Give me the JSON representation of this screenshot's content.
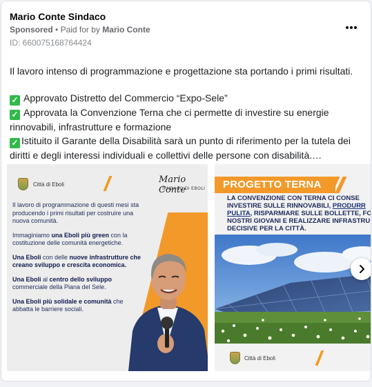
{
  "post": {
    "page_name": "Mario Conte Sindaco",
    "sponsored_label": "Sponsored",
    "paid_for_prefix": "Paid for by",
    "paid_for_name": "Mario Conte",
    "ad_id": "ID: 660075168764424",
    "body": {
      "intro": "Il lavoro intenso di programmazione e progettazione sta portando i primi risultati.",
      "item1": "Approvato Distretto del Commercio “Expo-Sele”",
      "item2": "Approvata la Convenzione Terna che ci permette di investire su energie rinnovabili, infrastrutture e formazione",
      "item3": "Istituito il Garante della Disabilità sarà un punto di riferimento per la tutela dei diritti e degli interessi individuali e collettivi delle persone con disabilità.…"
    }
  },
  "slide1": {
    "city": "Città di Eboli",
    "signature": "Mario Conte",
    "signature_title": "SINDACO DI EBOLI",
    "p1": "Il lavoro di programmazione di questi mesi sta producendo i primi risultati per costruire una nuova comunità.",
    "p2_a": "Immaginiamo ",
    "p2_b": "una Eboli più green",
    "p2_c": " con la costituzione delle comunità energetiche.",
    "p3_a": "Una Eboli",
    "p3_b": " con delle ",
    "p3_c": "nuove infrastrutture che creano sviluppo e crescita economica.",
    "p4_a": "Una Eboli",
    "p4_b": " al ",
    "p4_c": "centro dello sviluppo",
    "p4_d": " commerciale della Piana del Sele.",
    "p5_a": "Una Eboli più solidale e comunità",
    "p5_b": " che abbatta le barriere sociali."
  },
  "slide2": {
    "title": "PROGETTO TERNA",
    "line1": "LA CONVENZIONE CON TERNA CI CONSE",
    "line2_a": "INVESTIRE SULLE RINNOVABILI, ",
    "line2_b": "PRODURR",
    "line3_a": "PULITA",
    "line3_b": ", RISPARMIARE SULLE BOLLETTE, FO",
    "line4": "NOSTRI GIOVANI E REALIZZARE INFRASTRU",
    "line5": "DECISIVE PER LA CITTÀ.",
    "city": "Città di Eboli"
  },
  "icons": {
    "more": "more-horizontal-icon",
    "next": "chevron-right-icon",
    "check": "check-mark-icon"
  },
  "colors": {
    "accent_orange": "#f2992a",
    "navy_text": "#1e2a5a",
    "check_green": "#31b94a"
  }
}
